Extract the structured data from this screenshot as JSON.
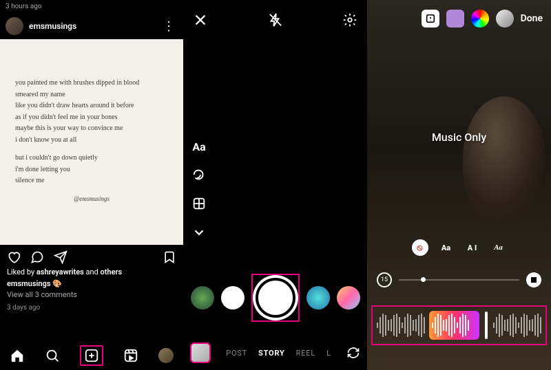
{
  "panel1": {
    "top_time": "3 hours ago",
    "username": "emsmusings",
    "post": {
      "lines1": [
        "you painted me with brushes dipped in blood",
        "smeared my name",
        "like you didn't draw hearts around it before",
        "as if you didn't feel me in your bones",
        "maybe this is your way to convince me",
        "i don't know you at all"
      ],
      "lines2": [
        "but i couldn't go down quietly",
        "i'm done letting you",
        "silence me"
      ],
      "signature": "@emsmusings"
    },
    "liked_prefix": "Liked by ",
    "liked_by": "ashreyawrites",
    "liked_suffix": " and ",
    "liked_others": "others",
    "caption_user": "emsmusings",
    "caption_emoji": "🎨",
    "view_comments": "View all 3 comments",
    "post_time": "3 days ago"
  },
  "panel2": {
    "text_tool": "Aa",
    "modes": {
      "post": "POST",
      "story": "STORY",
      "reel": "REEL",
      "live_prefix": "L"
    }
  },
  "panel3": {
    "done": "Done",
    "display_label": "Music Only",
    "duration": "15",
    "style_buttons": {
      "disabled": "⦸",
      "aa1": "Aa",
      "aa2": "A I",
      "aa3": "Aa"
    }
  }
}
